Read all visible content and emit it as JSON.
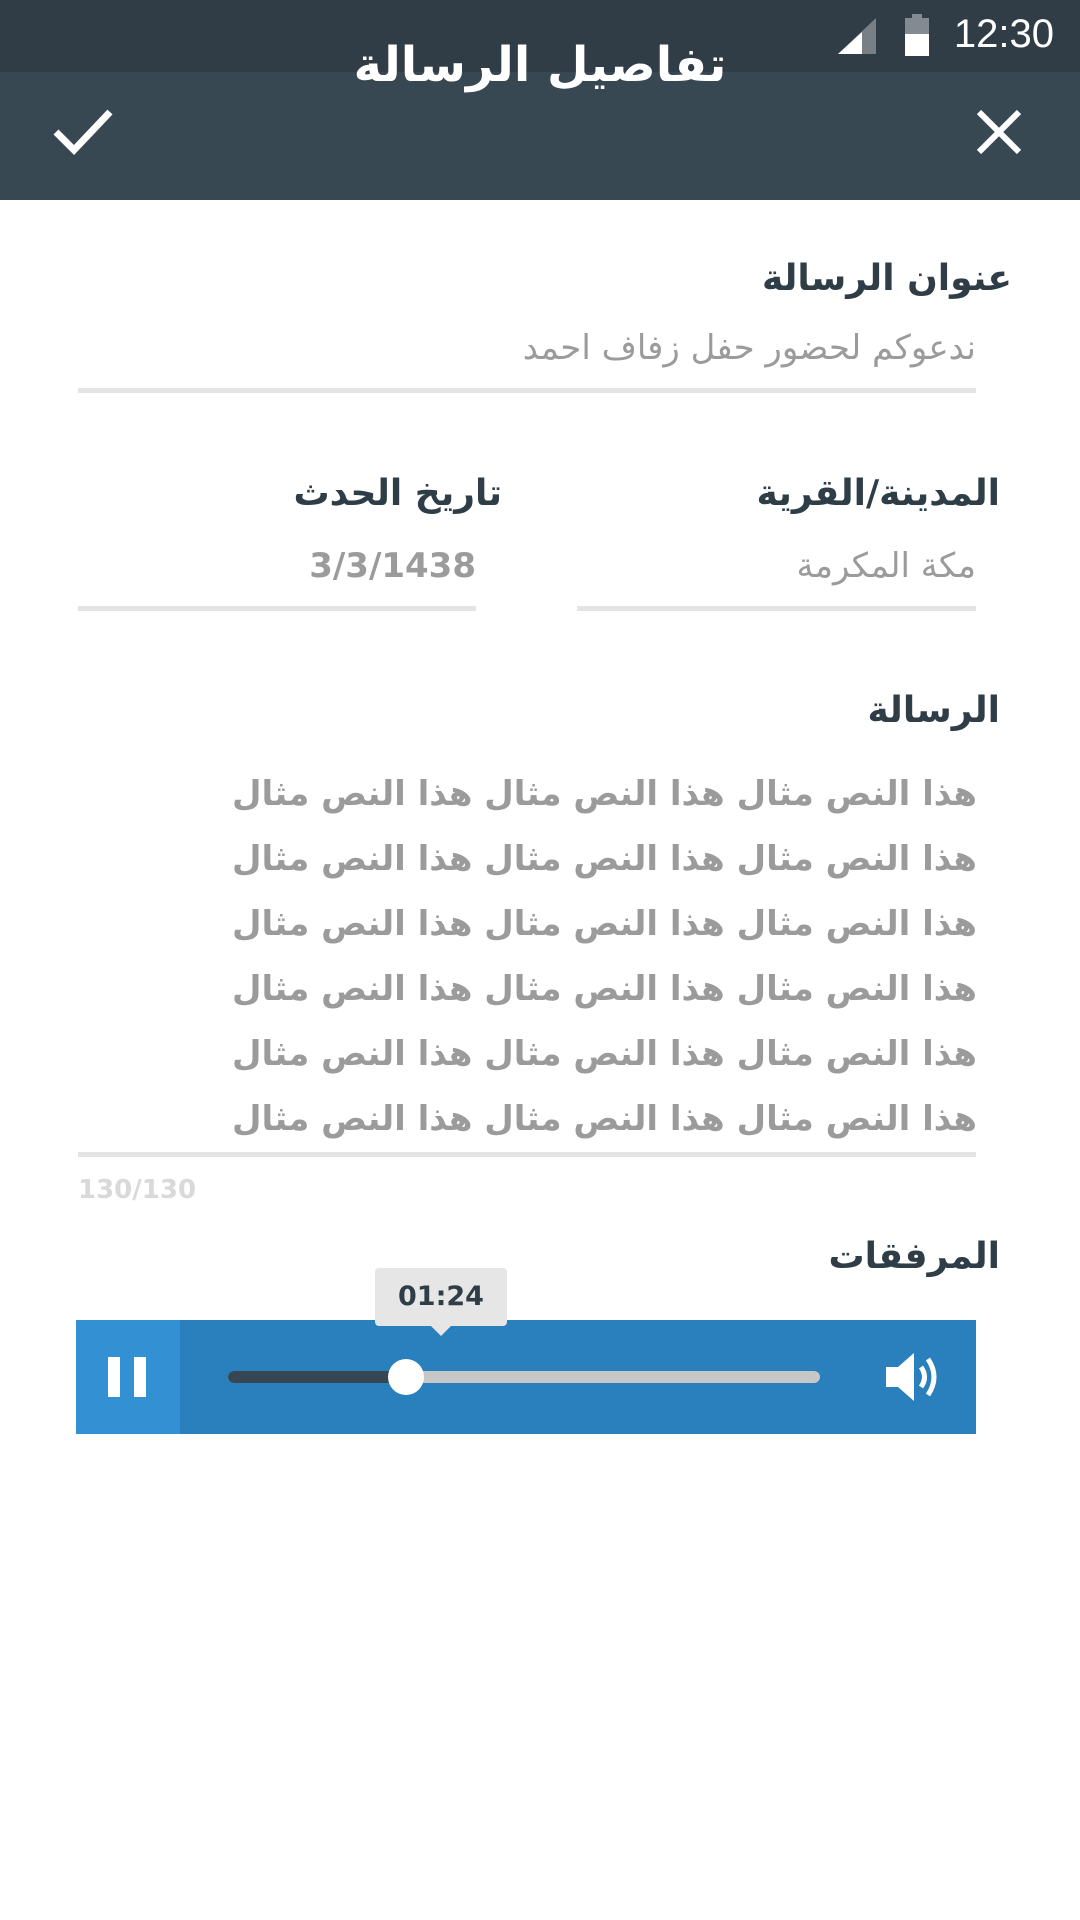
{
  "status_bar": {
    "time": "12:30",
    "signal_icon": "cell-signal-icon",
    "battery_icon": "battery-icon"
  },
  "app_bar": {
    "title": "تفاصيل الرسالة",
    "confirm_icon": "check-icon",
    "close_icon": "close-icon"
  },
  "form": {
    "subject": {
      "label": "عنوان الرسالة",
      "value": "ندعوكم لحضور حفل زفاف احمد"
    },
    "city": {
      "label": "المدينة/القرية",
      "value": "مكة المكرمة"
    },
    "event_date": {
      "label": "تاريخ الحدث",
      "value": "3/3/1438"
    },
    "message": {
      "label": "الرسالة",
      "lines": [
        "هذا النص مثال هذا النص مثال هذا النص مثال",
        "هذا النص مثال هذا النص مثال هذا النص مثال",
        "هذا النص مثال هذا النص مثال هذا النص مثال",
        "هذا النص مثال هذا النص مثال هذا النص مثال",
        "هذا النص مثال هذا النص مثال هذا النص مثال",
        "هذا النص مثال هذا النص مثال هذا النص مثال"
      ],
      "char_count": "130/130"
    },
    "attachments": {
      "label": "المرفقات",
      "audio_player": {
        "current_time": "01:24",
        "progress_fraction": 0.3,
        "pause_icon": "pause-icon",
        "volume_icon": "volume-icon"
      }
    }
  },
  "colors": {
    "status_bar": "#313d46",
    "app_bar": "#374853",
    "player": "#2a80bc",
    "pause_button": "#3290d3"
  }
}
